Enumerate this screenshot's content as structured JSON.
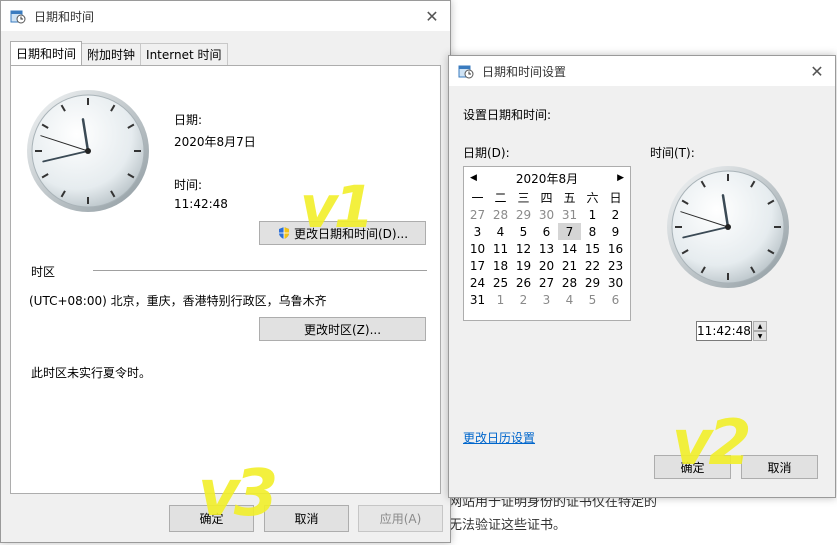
{
  "bg_text": {
    "line1": "网站用于证明身份的证书仅在特定的",
    "line2": "无法验证这些证书。"
  },
  "main": {
    "title": "日期和时间",
    "tabs": [
      "日期和时间",
      "附加时钟",
      "Internet 时间"
    ],
    "date_label": "日期:",
    "date_value": "2020年8月7日",
    "time_label": "时间:",
    "time_value": "11:42:48",
    "change_datetime_button": "更改日期和时间(D)...",
    "timezone_header": "时区",
    "timezone_value": "(UTC+08:00) 北京，重庆，香港特别行政区，乌鲁木齐",
    "change_timezone_button": "更改时区(Z)...",
    "dst_note": "此时区未实行夏令时。",
    "ok": "确定",
    "cancel": "取消",
    "apply": "应用(A)"
  },
  "settings": {
    "title": "日期和时间设置",
    "heading": "设置日期和时间:",
    "date_label": "日期(D):",
    "time_label": "时间(T):",
    "calendar": {
      "month": "2020年8月",
      "weekdays": [
        "一",
        "二",
        "三",
        "四",
        "五",
        "六",
        "日"
      ],
      "days": [
        {
          "d": "27",
          "dim": true
        },
        {
          "d": "28",
          "dim": true
        },
        {
          "d": "29",
          "dim": true
        },
        {
          "d": "30",
          "dim": true
        },
        {
          "d": "31",
          "dim": true
        },
        {
          "d": "1"
        },
        {
          "d": "2"
        },
        {
          "d": "3"
        },
        {
          "d": "4"
        },
        {
          "d": "5"
        },
        {
          "d": "6"
        },
        {
          "d": "7",
          "sel": true
        },
        {
          "d": "8"
        },
        {
          "d": "9"
        },
        {
          "d": "10"
        },
        {
          "d": "11"
        },
        {
          "d": "12"
        },
        {
          "d": "13"
        },
        {
          "d": "14"
        },
        {
          "d": "15"
        },
        {
          "d": "16"
        },
        {
          "d": "17"
        },
        {
          "d": "18"
        },
        {
          "d": "19"
        },
        {
          "d": "20"
        },
        {
          "d": "21"
        },
        {
          "d": "22"
        },
        {
          "d": "23"
        },
        {
          "d": "24"
        },
        {
          "d": "25"
        },
        {
          "d": "26"
        },
        {
          "d": "27"
        },
        {
          "d": "28"
        },
        {
          "d": "29"
        },
        {
          "d": "30"
        },
        {
          "d": "31"
        },
        {
          "d": "1",
          "dim": true
        },
        {
          "d": "2",
          "dim": true
        },
        {
          "d": "3",
          "dim": true
        },
        {
          "d": "4",
          "dim": true
        },
        {
          "d": "5",
          "dim": true
        },
        {
          "d": "6",
          "dim": true
        }
      ]
    },
    "time_value": "11:42:48",
    "change_calendar_link": "更改日历设置",
    "ok": "确定",
    "cancel": "取消"
  },
  "annotations": {
    "v1": "v1",
    "v2": "v2",
    "v3": "v3",
    "color": "#f2ef2a"
  },
  "clock_time": {
    "hour": 11,
    "minute": 42,
    "second": 48
  }
}
